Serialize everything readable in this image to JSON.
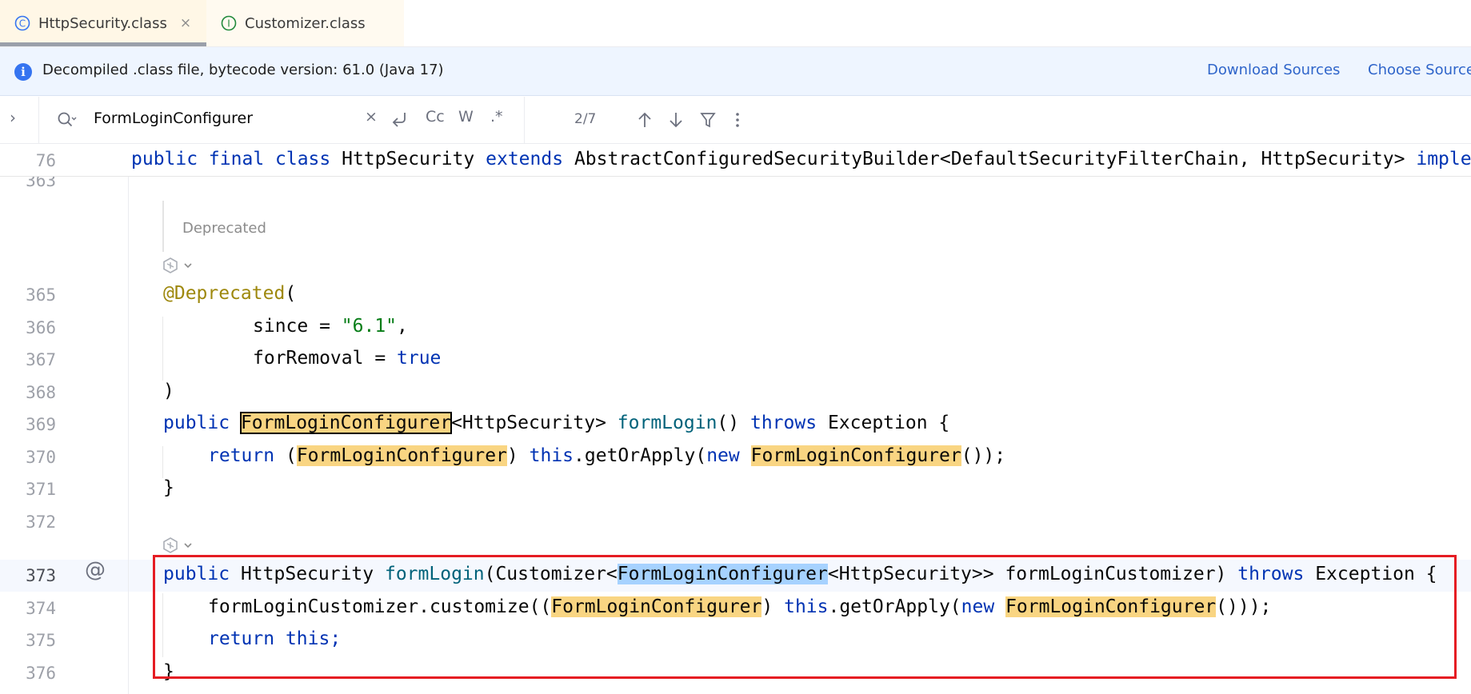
{
  "tabs": [
    {
      "label": "HttpSecurity.class",
      "active": true
    },
    {
      "label": "Customizer.class",
      "active": false
    }
  ],
  "tab_close_glyph": "×",
  "banner": {
    "text": "Decompiled .class file, bytecode version: 61.0 (Java 17)",
    "download_sources": "Download Sources",
    "choose_sources": "Choose Sources..."
  },
  "search": {
    "value": "FormLoginConfigurer",
    "clear": "×",
    "match_case": "Cc",
    "words": "W",
    "regex": ".*",
    "counter": "2/7"
  },
  "editor": {
    "sticky": {
      "line": "76",
      "pre": "public final class",
      "name": "HttpSecurity",
      "extends": "extends",
      "base": "AbstractConfiguredSecurityBuilder<DefaultSecurityFilterChain, HttpSecurity>",
      "impl": "implements"
    },
    "lines": {
      "l363": "363",
      "l365": "365",
      "l366": "366",
      "l367": "367",
      "l368": "368",
      "l369": "369",
      "l370": "370",
      "l371": "371",
      "l372": "372",
      "l373": "373",
      "l374": "374",
      "l375": "375",
      "l376": "376"
    },
    "doc_deprecated": "Deprecated",
    "code": {
      "annotation": "@Deprecated",
      "paren_open": "(",
      "since": "since = ",
      "since_val": "\"6.1\"",
      "comma": ",",
      "forRemoval": "forRemoval = ",
      "true": "true",
      "paren_close": ")",
      "public": "public",
      "flc": "FormLoginConfigurer",
      "generic_hs": "<HttpSecurity>",
      "formLogin": "formLogin",
      "parens": "()",
      "throws": "throws",
      "exception_brace": "Exception {",
      "return": "return",
      "open_paren": "(",
      "close_paren": ")",
      "this": "this",
      "getOrApply": ".getOrApply(",
      "new": "new",
      "call_end": "());",
      "brace_close": "}",
      "httpsecurity": "HttpSecurity",
      "customizer_open": "(Customizer<",
      "generic_hs2": "<HttpSecurity>> formLoginCustomizer)",
      "customize": "formLoginCustomizer.customize((",
      "call_end2": "()));",
      "this_semicolon": "this;"
    },
    "gutter_at": "@"
  }
}
